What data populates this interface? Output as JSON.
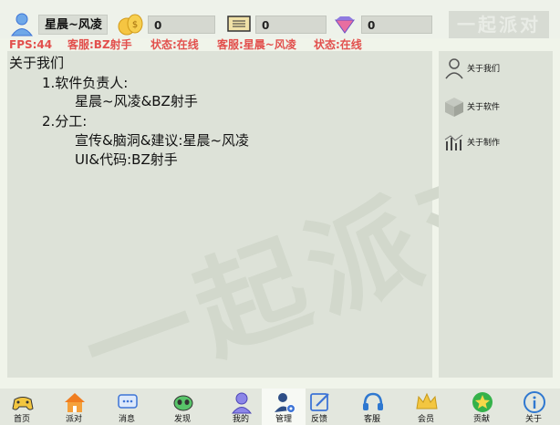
{
  "header": {
    "username": "星晨~风凌",
    "coins": "0",
    "tickets": "0",
    "diamonds": "0",
    "logo_text": "一起派对"
  },
  "status_bar": {
    "fps": "FPS:44",
    "service1": "客服:BZ射手",
    "state1": "状态:在线",
    "service2": "客服:星晨~风凌",
    "state2": "状态:在线"
  },
  "content": {
    "title": "关于我们",
    "item1_heading": "1.软件负责人:",
    "item1_value": "星晨~风凌&BZ射手",
    "item2_heading": "2.分工:",
    "item2_line1": "宣传&脑洞&建议:星晨~风凌",
    "item2_line2": "UI&代码:BZ射手",
    "watermark": "一起派对"
  },
  "sidebar": {
    "items": [
      {
        "label": "关于我们",
        "icon": "person-icon"
      },
      {
        "label": "关于软件",
        "icon": "cube-icon"
      },
      {
        "label": "关于制作",
        "icon": "bar-chart-icon"
      }
    ]
  },
  "bottom_nav": {
    "items": [
      {
        "label": "首页",
        "icon": "gamepad-icon"
      },
      {
        "label": "派对",
        "icon": "house-icon"
      },
      {
        "label": "消息",
        "icon": "chat-icon"
      },
      {
        "label": "发现",
        "icon": "alien-icon"
      },
      {
        "label": "我的",
        "icon": "user-icon"
      },
      {
        "label": "管理",
        "icon": "admin-gear-icon"
      },
      {
        "label": "反馈",
        "icon": "edit-icon"
      },
      {
        "label": "客服",
        "icon": "headset-icon"
      },
      {
        "label": "会员",
        "icon": "crown-icon"
      },
      {
        "label": "贡献",
        "icon": "star-badge-icon"
      },
      {
        "label": "关于",
        "icon": "info-icon"
      }
    ],
    "active": "管理"
  },
  "colors": {
    "status_red": "#e2504d",
    "panel_bg": "#dde2d8",
    "accent_blue": "#3d74d6"
  }
}
